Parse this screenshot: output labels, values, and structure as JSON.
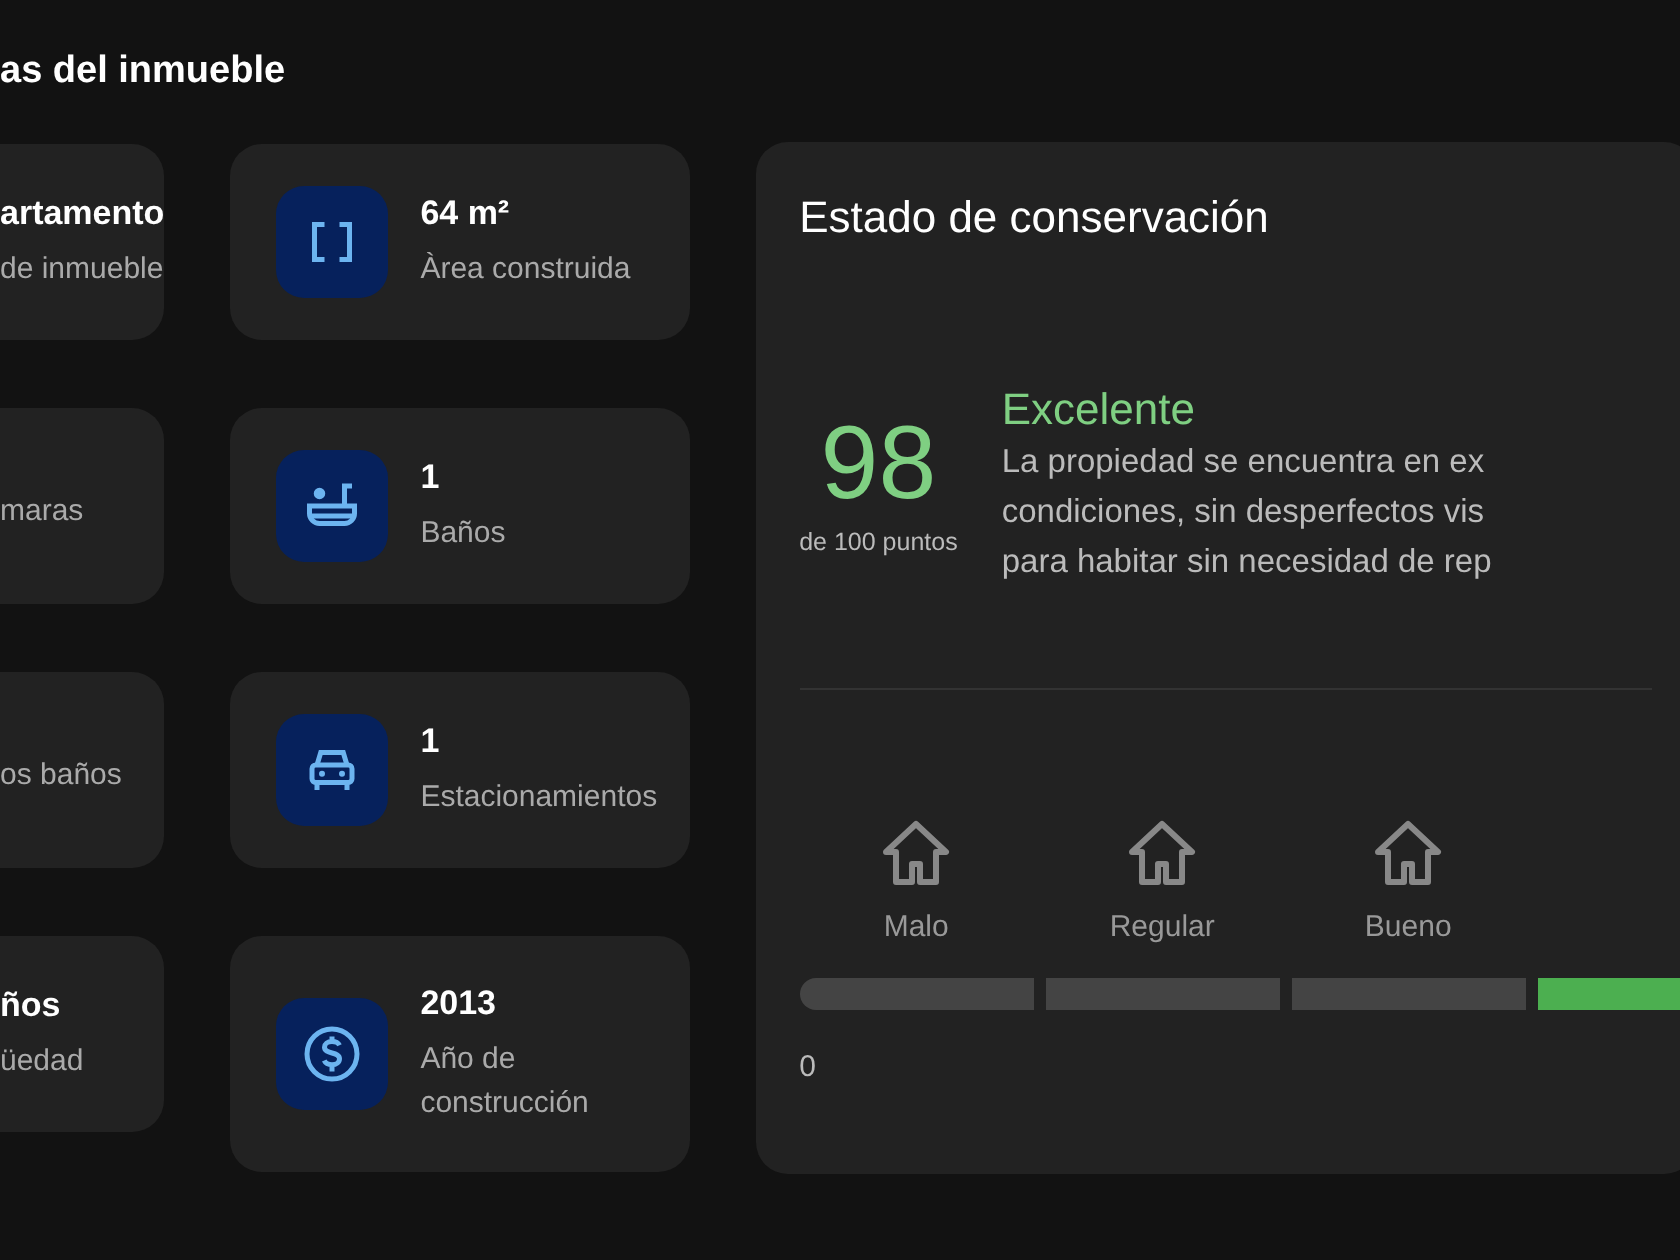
{
  "section_title": "as del inmueble",
  "features_left": [
    {
      "value": "artamento",
      "label": "de inmueble"
    },
    {
      "label": "maras"
    },
    {
      "label": "os baños"
    },
    {
      "value": "ños",
      "label": "üedad"
    }
  ],
  "features_right": [
    {
      "kind": "area",
      "value": "64 m²",
      "label": "Àrea construida"
    },
    {
      "kind": "bath",
      "value": "1",
      "label": "Baños"
    },
    {
      "kind": "car",
      "value": "1",
      "label": "Estacionamientos"
    },
    {
      "kind": "money",
      "value": "2013",
      "label": "Año de construcción"
    }
  ],
  "condition": {
    "title": "Estado de conservación",
    "score": "98",
    "score_caption": "de 100 puntos",
    "rating": "Excelente",
    "description_lines": [
      "La propiedad se encuentra en ex",
      "condiciones, sin desperfectos vis",
      "para habitar sin necesidad de rep"
    ],
    "scale": [
      {
        "label": "Malo",
        "active": false
      },
      {
        "label": "Regular",
        "active": false
      },
      {
        "label": "Bueno",
        "active": false
      },
      {
        "active": true
      }
    ],
    "scale_min": "0"
  }
}
